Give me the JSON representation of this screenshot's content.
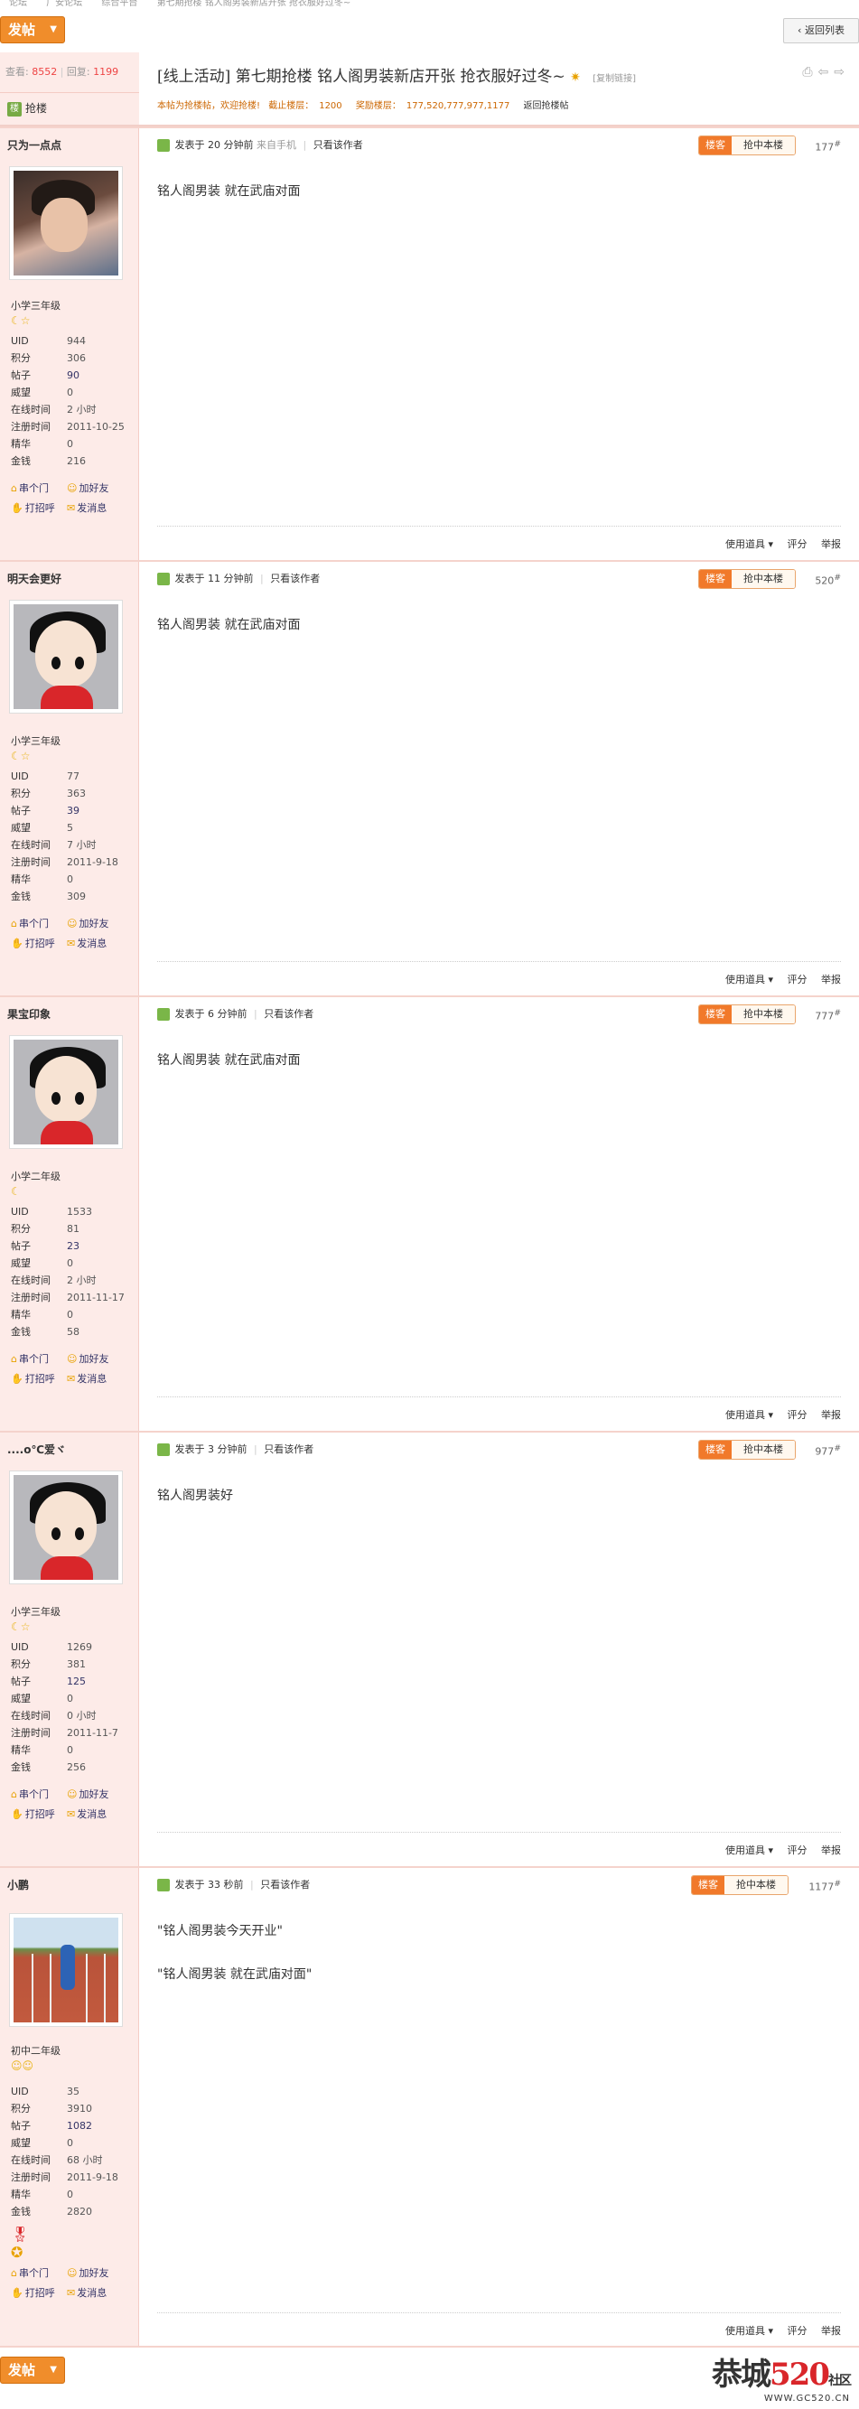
{
  "breadcrumb": [
    "论坛",
    "广安论坛",
    "综合平台",
    "第七期抢楼 铭人阁男装新店开张 抢衣服好过冬~"
  ],
  "toolbar": {
    "post_label": "发帖",
    "back_label": "返回列表"
  },
  "stats": {
    "views_label": "查看:",
    "views": "8552",
    "replies_label": "回复:",
    "replies": "1199"
  },
  "pick_label": "抢楼",
  "thread": {
    "title": "[线上活动] 第七期抢楼 铭人阁男装新店开张 抢衣服好过冬~",
    "copy_link": "[复制链接]",
    "sub": {
      "notice": "本帖为抢楼帖，欢迎抢楼!",
      "deadline_label": "截止楼层：",
      "deadline": "1200",
      "reward_label": "奖励楼层：",
      "reward": "177,520,777,977,1177",
      "back": "返回抢楼帖"
    }
  },
  "common": {
    "posted_prefix": "发表于",
    "only_author": "只看该作者",
    "btn_cheer": "楼客",
    "btn_floor": "抢中本楼",
    "foot_tools": "使用道具",
    "foot_rate": "评分",
    "foot_report": "举报",
    "act_home": "串个门",
    "act_friend": "加好友",
    "act_greet": "打招呼",
    "act_msg": "发消息",
    "labels": {
      "uid": "UID",
      "points": "积分",
      "posts": "帖子",
      "prestige": "威望",
      "online": "在线时间",
      "reg": "注册时间",
      "digest": "精华",
      "money": "金钱"
    }
  },
  "posts": [
    {
      "user": "只为一点点",
      "rank": "小学三年级",
      "stars": "☾☆",
      "uid": "944",
      "points": "306",
      "posts": "90",
      "prestige": "0",
      "online": "2 小时",
      "reg": "2011-10-25",
      "digest": "0",
      "money": "216",
      "time": "20 分钟前",
      "via": "来自手机",
      "floor": "177",
      "content": [
        "铭人阁男装 就在武庙对面"
      ]
    },
    {
      "user": "明天会更好",
      "rank": "小学三年级",
      "stars": "☾☆",
      "uid": "77",
      "points": "363",
      "posts": "39",
      "prestige": "5",
      "online": "7 小时",
      "reg": "2011-9-18",
      "digest": "0",
      "money": "309",
      "time": "11 分钟前",
      "via": "",
      "floor": "520",
      "content": [
        "铭人阁男装 就在武庙对面"
      ]
    },
    {
      "user": "果宝印象",
      "rank": "小学二年级",
      "stars": "☾",
      "uid": "1533",
      "points": "81",
      "posts": "23",
      "prestige": "0",
      "online": "2 小时",
      "reg": "2011-11-17",
      "digest": "0",
      "money": "58",
      "time": "6 分钟前",
      "via": "",
      "floor": "777",
      "content": [
        "铭人阁男装 就在武庙对面"
      ]
    },
    {
      "user": "....o℃爱ヾ",
      "rank": "小学三年级",
      "stars": "☾☆",
      "uid": "1269",
      "points": "381",
      "posts": "125",
      "prestige": "0",
      "online": "0 小时",
      "reg": "2011-11-7",
      "digest": "0",
      "money": "256",
      "time": "3 分钟前",
      "via": "",
      "floor": "977",
      "content": [
        "铭人阁男装好"
      ]
    },
    {
      "user": "小鹏",
      "rank": "初中二年级",
      "stars": "☺☺",
      "uid": "35",
      "points": "3910",
      "posts": "1082",
      "prestige": "0",
      "online": "68 小时",
      "reg": "2011-9-18",
      "digest": "0",
      "money": "2820",
      "time": "33 秒前",
      "via": "",
      "floor": "1177",
      "content": [
        "\"铭人阁男装今天开业\"",
        "\"铭人阁男装 就在武庙对面\""
      ]
    }
  ],
  "watermark": {
    "brand_a": "恭城",
    "brand_b": "520",
    "brand_c": "社区",
    "url": "WWW.GC520.CN"
  }
}
